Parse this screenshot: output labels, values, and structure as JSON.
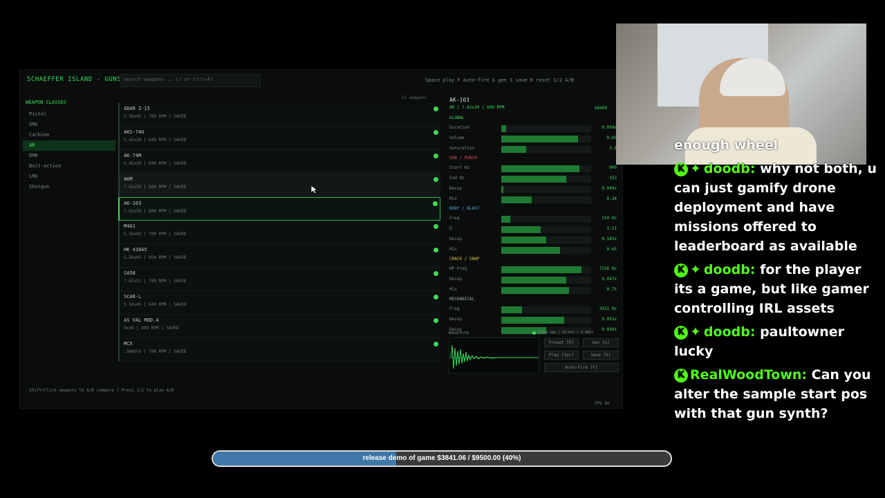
{
  "app": {
    "title": "SCHAEFFER ISLAND - GUNS",
    "search_placeholder": "Search weapons... (/ or Ctrl+F)",
    "shortcuts": "Space play   F auto-fire   G gen   S save   R reset   1/2 A/B",
    "footer_hint": "Shift+Click weapons to A/B compare  |  Press 1/2 to play A/B",
    "fps": "FPS 60"
  },
  "sidebar": {
    "heading": "WEAPON CLASSES",
    "items": [
      "Pistol",
      "SMG",
      "Carbine",
      "AR",
      "DMR",
      "Bolt-Action",
      "LMG",
      "Shotgun"
    ],
    "active": "AR"
  },
  "list": {
    "count": "11 weapons",
    "rows": [
      {
        "name": "ADAR 2-15",
        "meta": "5.56x45  |  700 RPM  |  SAVED"
      },
      {
        "name": "AKS-74U",
        "meta": "5.45x39  |  640 RPM  |  SAVED"
      },
      {
        "name": "AK-74M",
        "meta": "5.45x39  |  640 RPM  |  SAVED"
      },
      {
        "name": "AKM",
        "meta": "7.62x39  |  600 RPM  |  SAVED"
      },
      {
        "name": "AK-103",
        "meta": "7.62x39  |  600 RPM  |  SAVED"
      },
      {
        "name": "M4A1",
        "meta": "5.56x45  |  700 RPM  |  SAVED"
      },
      {
        "name": "HK 416A5",
        "meta": "5.56x45  |  850 RPM  |  SAVED"
      },
      {
        "name": "SA58",
        "meta": "7.62x51  |  700 RPM  |  SAVED"
      },
      {
        "name": "SCAR-L",
        "meta": "5.56x45  |  640 RPM  |  SAVED"
      },
      {
        "name": "AS VAL MOD.4",
        "meta": "9x39  |  900 RPM  |  SAVED"
      },
      {
        "name": "MCX",
        "meta": ".300blk  |  700 RPM  |  SAVED"
      }
    ]
  },
  "detail": {
    "name": "AK-103",
    "meta": "AR  |  7.62x39  |  600 RPM",
    "saved": "SAVED",
    "sections": [
      {
        "title": "GLOBAL",
        "color": "#3ddc5a",
        "params": [
          {
            "label": "Duration",
            "value": "0.050s",
            "fill": 0.05
          },
          {
            "label": "Volume",
            "value": "0.85",
            "fill": 0.85
          },
          {
            "label": "Saturation",
            "value": "3.0",
            "fill": 0.28
          }
        ]
      },
      {
        "title": "SUB / PUNCH",
        "color": "#e05050",
        "params": [
          {
            "label": "Start Hz",
            "value": "900",
            "fill": 0.87
          },
          {
            "label": "End Hz",
            "value": "153",
            "fill": 0.72
          },
          {
            "label": "Decay",
            "value": "0.040s",
            "fill": 0.02
          },
          {
            "label": "Mix",
            "value": "0.34",
            "fill": 0.34
          }
        ]
      },
      {
        "title": "BODY / BLAST",
        "color": "#4aa8e0",
        "params": [
          {
            "label": "Freq",
            "value": "310 Hz",
            "fill": 0.1
          },
          {
            "label": "Q",
            "value": "1.51",
            "fill": 0.44
          },
          {
            "label": "Decay",
            "value": "0.165s",
            "fill": 0.5
          },
          {
            "label": "Mix",
            "value": "0.65",
            "fill": 0.65
          }
        ]
      },
      {
        "title": "CRACK / SNAP",
        "color": "#e0c040",
        "params": [
          {
            "label": "HP Freq",
            "value": "7226 Hz",
            "fill": 0.89
          },
          {
            "label": "Decay",
            "value": "0.047s",
            "fill": 0.72
          },
          {
            "label": "Mix",
            "value": "0.75",
            "fill": 0.75
          }
        ]
      },
      {
        "title": "MECHANICAL",
        "color": "#9aa8a8",
        "params": [
          {
            "label": "Freq",
            "value": "3421 Hz",
            "fill": 0.23
          },
          {
            "label": "Decay",
            "value": "0.051s",
            "fill": 0.7
          },
          {
            "label": "Decay",
            "value": "0.030s",
            "fill": 0.5
          }
        ]
      }
    ],
    "waveform_label": "Waveform",
    "waveform_info": "42359 smp | 16-bit | 0.961s",
    "buttons": {
      "preset": "Preset [R]",
      "gen": "Gen [G]",
      "play": "Play [Spc]",
      "save": "Save [S]",
      "autofire": "Auto-Fire [F]"
    }
  },
  "webcam": {
    "caption": "enough wheel"
  },
  "chat": [
    {
      "user": "doodb",
      "badge": "K",
      "extra_badge": true,
      "text": "why not both, u can just gamify drone deployment and have missions offered to leaderboard as available"
    },
    {
      "user": "doodb",
      "badge": "K",
      "extra_badge": true,
      "text": "for the player its a game, but like gamer controlling IRL assets"
    },
    {
      "user": "doodb",
      "badge": "K",
      "extra_badge": true,
      "text": "paultowner lucky"
    },
    {
      "user": "RealWoodTown",
      "badge": "K",
      "extra_badge": false,
      "text": "Can you alter the sample start pos with that gun synth?"
    }
  ],
  "goal": {
    "text": "release demo of game $3841.06 / $9500.00 (40%)",
    "progress": 0.4
  }
}
